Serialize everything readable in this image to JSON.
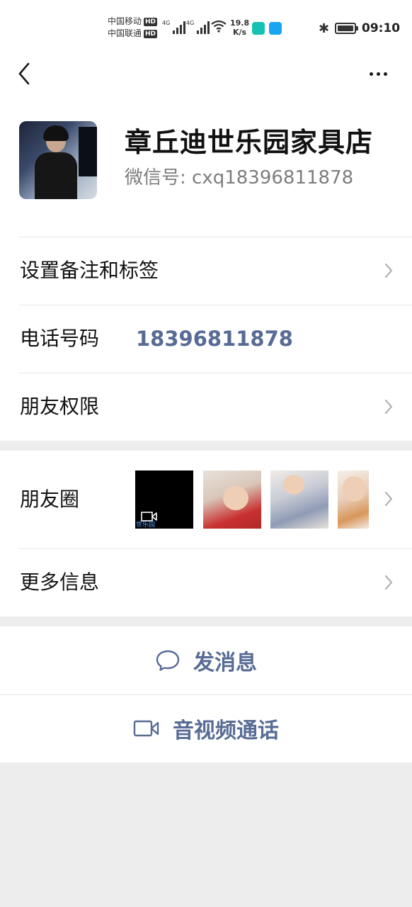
{
  "status_bar": {
    "carrier1": "中国移动",
    "carrier2": "中国联通",
    "hd": "HD",
    "network1": "4G",
    "network2": "4G",
    "speed_value": "19.8",
    "speed_unit": "K/s",
    "time": "09:10"
  },
  "profile": {
    "name": "章丘迪世乐园家具店",
    "wechat_id": "微信号: cxq18396811878"
  },
  "rows": {
    "remark": "设置备注和标签",
    "phone_label": "电话号码",
    "phone_value": "18396811878",
    "permissions": "朋友权限",
    "moments": "朋友圈",
    "more_info": "更多信息"
  },
  "moments_thumbs": {
    "video_label": "世乐园"
  },
  "actions": {
    "message": "发消息",
    "call": "音视频通话"
  },
  "colors": {
    "link_blue": "#576b95",
    "page_bg": "#ededed"
  }
}
